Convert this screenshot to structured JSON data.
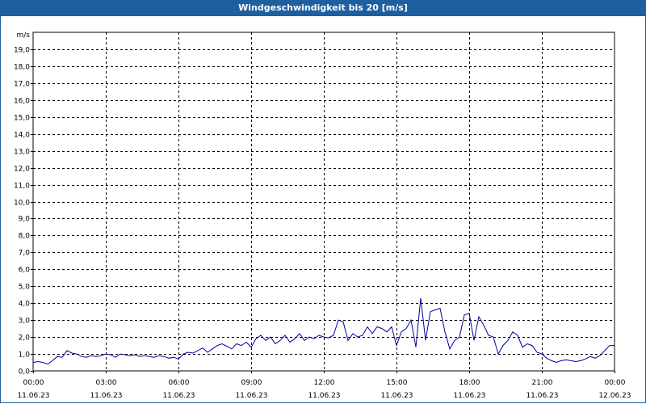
{
  "window": {
    "title": "Windgeschwindigkeit bis 20 [m/s]"
  },
  "colors": {
    "titlebar": "#1e5fa0",
    "series": "#0000a0",
    "grid": "#000000"
  },
  "chart_data": {
    "type": "line",
    "title": "Windgeschwindigkeit bis 20 [m/s]",
    "ylabel": "m/s",
    "xlabel": "",
    "ylim": [
      0,
      20
    ],
    "xlim_hours": [
      0,
      24
    ],
    "grid": true,
    "y_ticks": [
      "0,0",
      "1,0",
      "2,0",
      "3,0",
      "4,0",
      "5,0",
      "6,0",
      "7,0",
      "8,0",
      "9,0",
      "10,0",
      "11,0",
      "12,0",
      "13,0",
      "14,0",
      "15,0",
      "16,0",
      "17,0",
      "18,0",
      "19,0"
    ],
    "x_ticks": [
      {
        "time": "00:00",
        "date": "11.06.23"
      },
      {
        "time": "03:00",
        "date": "11.06.23"
      },
      {
        "time": "06:00",
        "date": "11.06.23"
      },
      {
        "time": "09:00",
        "date": "11.06.23"
      },
      {
        "time": "12:00",
        "date": "11.06.23"
      },
      {
        "time": "15:00",
        "date": "11.06.23"
      },
      {
        "time": "18:00",
        "date": "11.06.23"
      },
      {
        "time": "21:00",
        "date": "11.06.23"
      },
      {
        "time": "00:00",
        "date": "12.06.23"
      }
    ],
    "series": [
      {
        "x_hours": [
          0.0,
          0.2,
          0.4,
          0.6,
          0.8,
          1.0,
          1.2,
          1.4,
          1.6,
          1.8,
          2.0,
          2.2,
          2.4,
          2.6,
          2.8,
          3.0,
          3.2,
          3.4,
          3.6,
          3.8,
          4.0,
          4.2,
          4.4,
          4.6,
          4.8,
          5.0,
          5.2,
          5.4,
          5.6,
          5.8,
          6.0,
          6.2,
          6.4,
          6.6,
          6.8,
          7.0,
          7.2,
          7.4,
          7.6,
          7.8,
          8.0,
          8.2,
          8.4,
          8.6,
          8.8,
          9.0,
          9.2,
          9.4,
          9.6,
          9.8,
          10.0,
          10.2,
          10.4,
          10.6,
          10.8,
          11.0,
          11.2,
          11.4,
          11.6,
          11.8,
          12.0,
          12.2,
          12.4,
          12.6,
          12.8,
          13.0,
          13.2,
          13.4,
          13.6,
          13.8,
          14.0,
          14.2,
          14.4,
          14.6,
          14.8,
          15.0,
          15.2,
          15.4,
          15.6,
          15.8,
          16.0,
          16.2,
          16.4,
          16.6,
          16.8,
          17.0,
          17.2,
          17.4,
          17.6,
          17.8,
          18.0,
          18.2,
          18.4,
          18.6,
          18.8,
          19.0,
          19.2,
          19.4,
          19.6,
          19.8,
          20.0,
          20.2,
          20.4,
          20.6,
          20.8,
          21.0,
          21.2,
          21.4,
          21.6,
          21.8,
          22.0,
          22.2,
          22.4,
          22.6,
          22.8,
          23.0,
          23.2,
          23.4,
          23.6,
          23.8,
          24.0
        ],
        "values": [
          0.5,
          0.55,
          0.5,
          0.4,
          0.6,
          0.85,
          0.8,
          1.2,
          1.05,
          1.0,
          0.85,
          0.8,
          0.9,
          0.85,
          0.9,
          1.0,
          0.95,
          0.8,
          1.0,
          0.95,
          0.9,
          0.95,
          0.85,
          0.9,
          0.85,
          0.8,
          0.9,
          0.85,
          0.75,
          0.8,
          0.7,
          1.0,
          1.1,
          1.05,
          1.2,
          1.35,
          1.1,
          1.3,
          1.5,
          1.6,
          1.45,
          1.3,
          1.6,
          1.5,
          1.7,
          1.4,
          1.9,
          2.1,
          1.8,
          2.0,
          1.6,
          1.8,
          2.1,
          1.7,
          1.9,
          2.2,
          1.8,
          2.0,
          1.9,
          2.1,
          2.0,
          1.95,
          2.1,
          3.0,
          2.9,
          1.8,
          2.2,
          2.0,
          2.1,
          2.6,
          2.2,
          2.6,
          2.5,
          2.3,
          2.6,
          1.5,
          2.3,
          2.5,
          3.0,
          1.4,
          4.3,
          1.8,
          3.5,
          3.6,
          3.7,
          2.3,
          1.3,
          1.8,
          2.0,
          3.3,
          3.4,
          1.8,
          3.2,
          2.7,
          2.1,
          2.0,
          1.0,
          1.5,
          1.8,
          2.3,
          2.1,
          1.4,
          1.6,
          1.5,
          1.1,
          1.0,
          0.75,
          0.6,
          0.5,
          0.6,
          0.65,
          0.6,
          0.55,
          0.6,
          0.7,
          0.85,
          0.75,
          0.9,
          1.2,
          1.5,
          1.5,
          1.0
        ]
      }
    ]
  }
}
